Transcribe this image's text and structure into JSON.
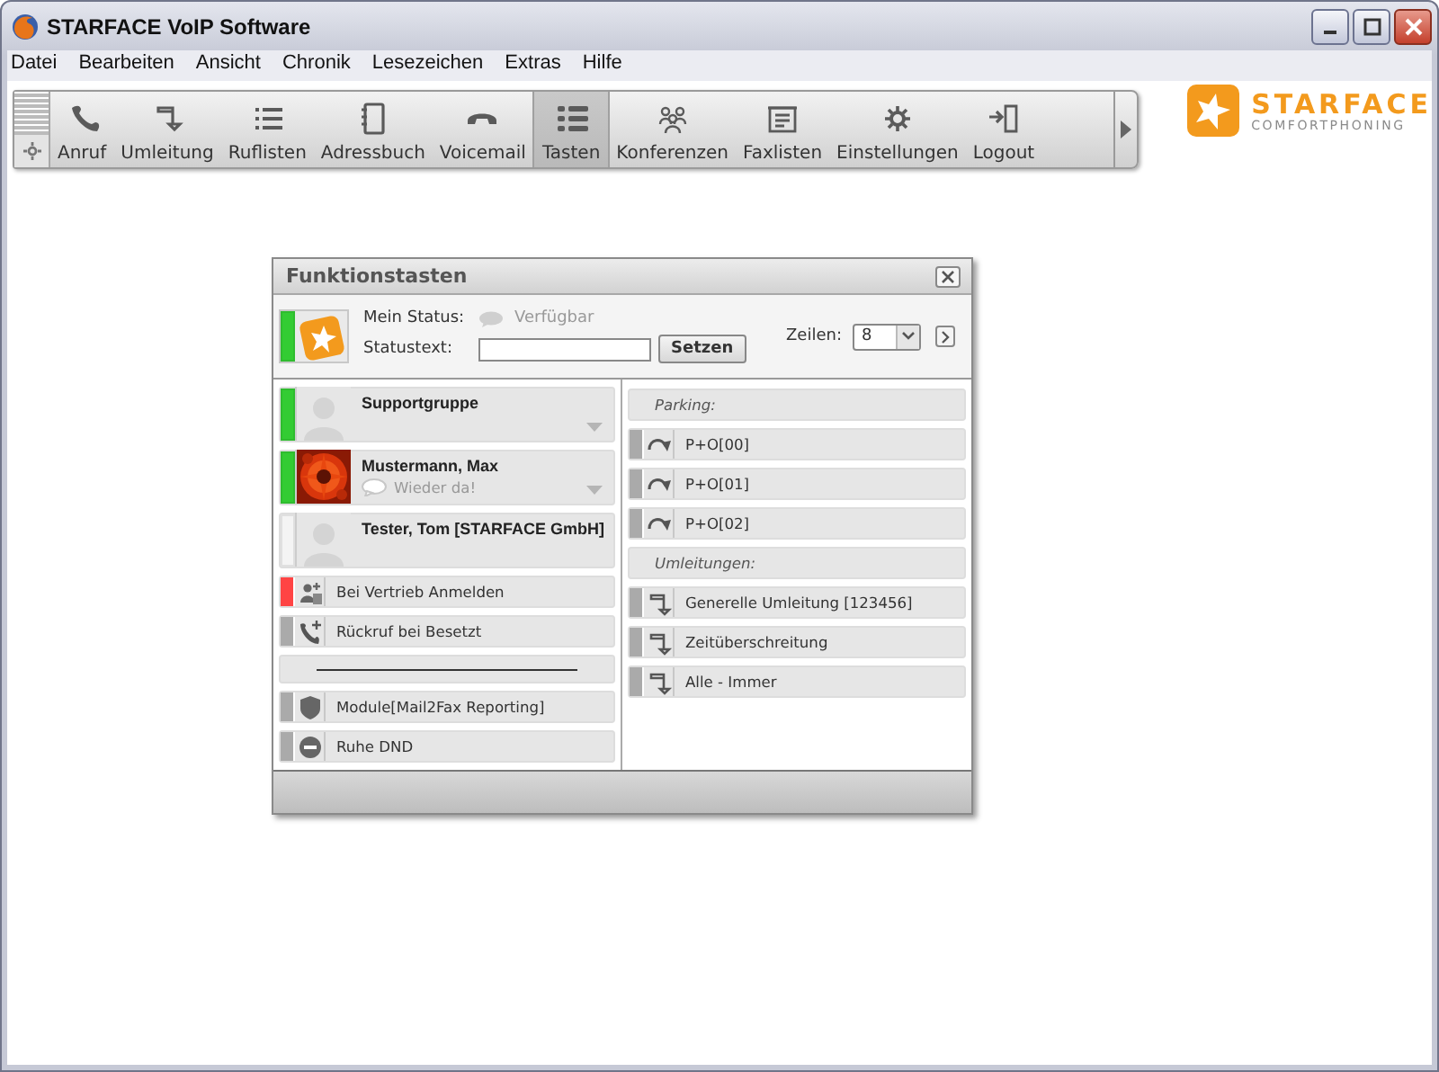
{
  "window": {
    "title": "STARFACE VoIP Software"
  },
  "menu": [
    {
      "label": "Datei"
    },
    {
      "label": "Bearbeiten"
    },
    {
      "label": "Ansicht"
    },
    {
      "label": "Chronik"
    },
    {
      "label": "Lesezeichen"
    },
    {
      "label": "Extras"
    },
    {
      "label": "Hilfe"
    }
  ],
  "toolbar": [
    {
      "label": "Anruf",
      "selected": false
    },
    {
      "label": "Umleitung",
      "selected": false
    },
    {
      "label": "Ruflisten",
      "selected": false
    },
    {
      "label": "Adressbuch",
      "selected": false
    },
    {
      "label": "Voicemail",
      "selected": false
    },
    {
      "label": "Tasten",
      "selected": true
    },
    {
      "label": "Konferenzen",
      "selected": false
    },
    {
      "label": "Faxlisten",
      "selected": false
    },
    {
      "label": "Einstellungen",
      "selected": false
    },
    {
      "label": "Logout",
      "selected": false
    }
  ],
  "logo": {
    "name": "STARFACE",
    "tagline": "COMFORTPHONING"
  },
  "dialog": {
    "title": "Funktionstasten",
    "own": {
      "color": "#33cc33"
    },
    "status_label": "Mein Status:",
    "status_value": "Verfügbar",
    "statustext_label": "Statustext:",
    "set_button": "Setzen",
    "rows_label": "Zeilen:",
    "rows_value": "8",
    "left": [
      {
        "kind": "contact",
        "name": "Supportgruppe",
        "color": "#33cc33",
        "photo": false,
        "menu": true
      },
      {
        "kind": "contact",
        "name": "Mustermann, Max",
        "color": "#33cc33",
        "photo": true,
        "note": "Wieder da!",
        "menu": true
      },
      {
        "kind": "contact",
        "name": "Tester, Tom [STARFACE GmbH]",
        "color": "#f4f4f4",
        "photo": false,
        "menu": false
      },
      {
        "kind": "login",
        "label": "Bei Vertrieb Anmelden",
        "color": "#ff4444"
      },
      {
        "kind": "callback",
        "label": "Rückruf bei Besetzt",
        "color": "#aaaaaa"
      },
      {
        "kind": "separator"
      },
      {
        "kind": "module",
        "label": "Module[Mail2Fax Reporting]",
        "color": "#aaaaaa"
      },
      {
        "kind": "dnd",
        "label": "Ruhe DND",
        "color": "#aaaaaa"
      }
    ],
    "right": [
      {
        "kind": "heading",
        "label": "Parking:"
      },
      {
        "kind": "parking",
        "label": "P+O[00]",
        "color": "#aaaaaa"
      },
      {
        "kind": "parking",
        "label": "P+O[01]",
        "color": "#aaaaaa"
      },
      {
        "kind": "parking",
        "label": "P+O[02]",
        "color": "#aaaaaa"
      },
      {
        "kind": "heading",
        "label": "Umleitungen:"
      },
      {
        "kind": "redirect",
        "label": "Generelle Umleitung [123456]",
        "color": "#aaaaaa"
      },
      {
        "kind": "redirect",
        "label": "Zeitüberschreitung",
        "color": "#aaaaaa"
      },
      {
        "kind": "redirect",
        "label": "Alle - Immer",
        "color": "#aaaaaa"
      }
    ]
  }
}
